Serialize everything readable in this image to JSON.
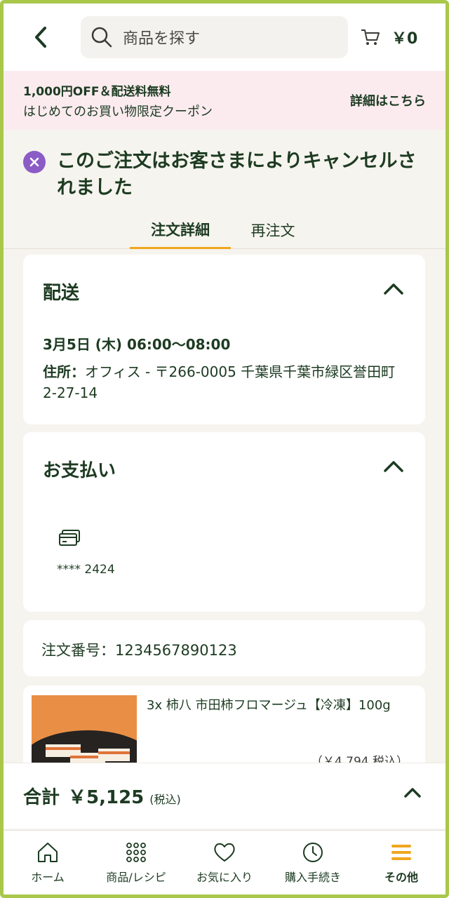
{
  "header": {
    "search_placeholder": "商品を探す",
    "cart_amount": "￥0"
  },
  "coupon": {
    "title": "1,000円OFF＆配送料無料",
    "subtitle": "はじめてのお買い物限定クーポン",
    "link": "詳細はこちら",
    "bg_color": "#fbebef"
  },
  "notice": {
    "text": "このご注文はお客さまによりキャンセルされました",
    "icon_color": "#8b5bc6"
  },
  "tabs": [
    {
      "label": "注文詳細",
      "active": true
    },
    {
      "label": "再注文",
      "active": false
    }
  ],
  "delivery": {
    "title": "配送",
    "datetime": "3月5日 (木) 06:00〜08:00",
    "address_label": "住所：",
    "address": "オフィス - 〒266-0005 千葉県千葉市緑区誉田町2-27-14"
  },
  "payment": {
    "title": "お支払い",
    "card_icon": "credit-card-icon",
    "card_number": "**** 2424"
  },
  "order": {
    "number_label": "注文番号：",
    "number": "1234567890123"
  },
  "product": {
    "name": "3x 柿八 市田柿フロマージュ【冷凍】100g",
    "price": "（￥4,794 税込）"
  },
  "total": {
    "label": "合計",
    "amount": "￥5,125",
    "tax_note": "(税込)"
  },
  "nav": [
    {
      "label": "ホーム",
      "icon": "home-icon",
      "active": false
    },
    {
      "label": "商品/レシピ",
      "icon": "grid-icon",
      "active": false
    },
    {
      "label": "お気に入り",
      "icon": "heart-icon",
      "active": false
    },
    {
      "label": "購入手続き",
      "icon": "clock-icon",
      "active": false
    },
    {
      "label": "その他",
      "icon": "menu-icon",
      "active": true
    }
  ],
  "colors": {
    "accent": "#f0a61f",
    "text": "#1d3b22",
    "frame": "#a9c84a"
  }
}
